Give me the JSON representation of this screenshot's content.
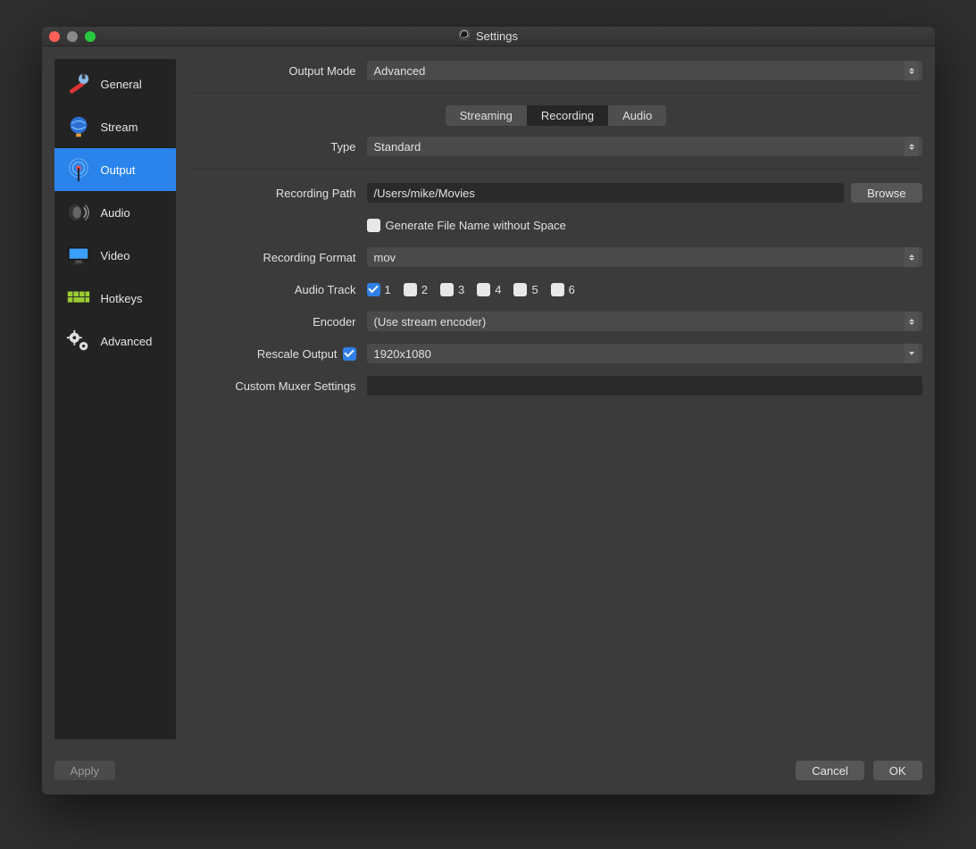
{
  "window": {
    "title": "Settings"
  },
  "sidebar": {
    "items": [
      {
        "label": "General"
      },
      {
        "label": "Stream"
      },
      {
        "label": "Output",
        "selected": true
      },
      {
        "label": "Audio"
      },
      {
        "label": "Video"
      },
      {
        "label": "Hotkeys"
      },
      {
        "label": "Advanced"
      }
    ]
  },
  "output_mode": {
    "label": "Output Mode",
    "value": "Advanced"
  },
  "tabs": {
    "streaming": "Streaming",
    "recording": "Recording",
    "audio": "Audio",
    "active": "recording"
  },
  "type": {
    "label": "Type",
    "value": "Standard"
  },
  "recording_path": {
    "label": "Recording Path",
    "value": "/Users/mike/Movies",
    "browse": "Browse"
  },
  "generate_no_space": {
    "label": "Generate File Name without Space",
    "checked": false
  },
  "recording_format": {
    "label": "Recording Format",
    "value": "mov"
  },
  "audio_track": {
    "label": "Audio Track",
    "tracks": [
      {
        "n": "1",
        "checked": true
      },
      {
        "n": "2",
        "checked": false
      },
      {
        "n": "3",
        "checked": false
      },
      {
        "n": "4",
        "checked": false
      },
      {
        "n": "5",
        "checked": false
      },
      {
        "n": "6",
        "checked": false
      }
    ]
  },
  "encoder": {
    "label": "Encoder",
    "value": "(Use stream encoder)"
  },
  "rescale": {
    "label": "Rescale Output",
    "checked": true,
    "value": "1920x1080"
  },
  "muxer": {
    "label": "Custom Muxer Settings",
    "value": ""
  },
  "buttons": {
    "apply": "Apply",
    "cancel": "Cancel",
    "ok": "OK"
  }
}
